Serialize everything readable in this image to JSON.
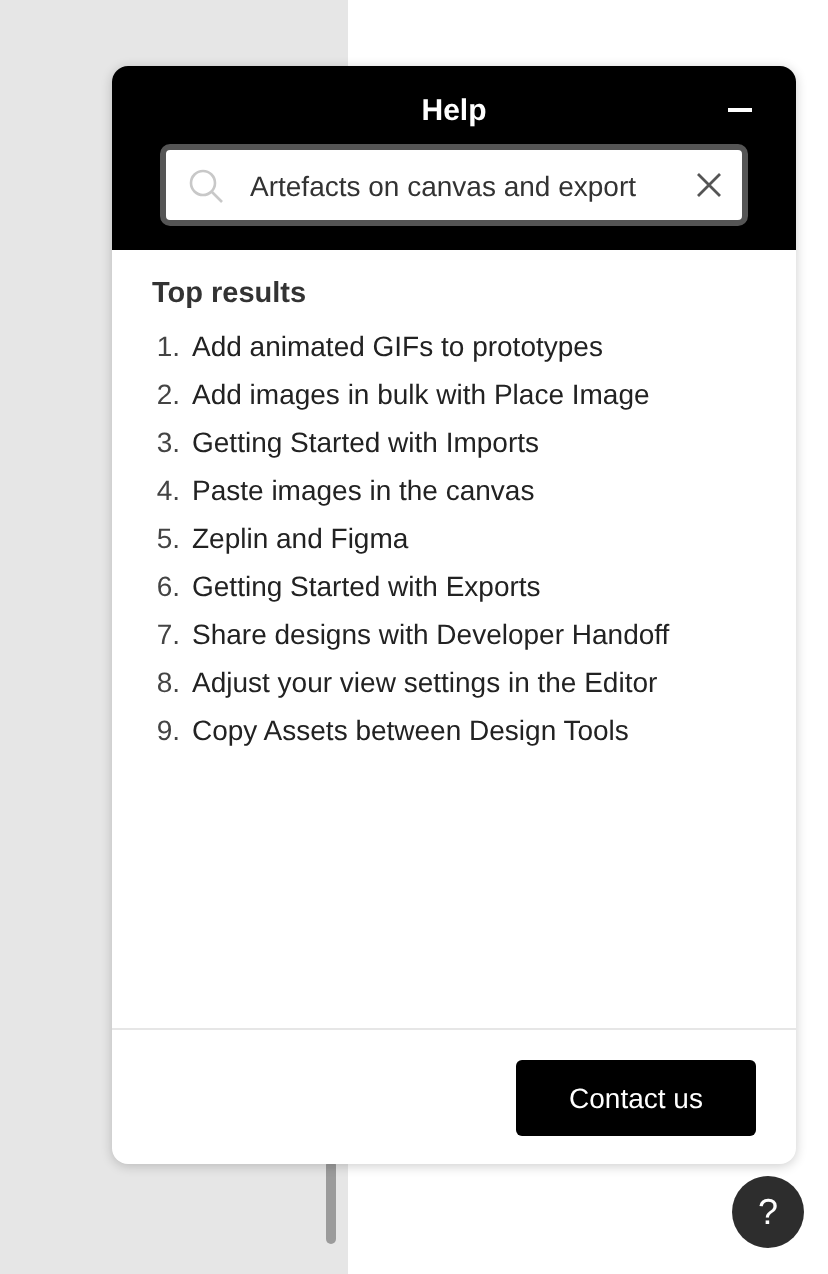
{
  "panel": {
    "title": "Help"
  },
  "search": {
    "value": "Artefacts on canvas and export"
  },
  "results": {
    "heading": "Top results",
    "items": [
      {
        "number": "1.",
        "title": "Add animated GIFs to prototypes"
      },
      {
        "number": "2.",
        "title": "Add images in bulk with Place Image"
      },
      {
        "number": "3.",
        "title": "Getting Started with Imports"
      },
      {
        "number": "4.",
        "title": "Paste images in the canvas"
      },
      {
        "number": "5.",
        "title": "Zeplin and Figma"
      },
      {
        "number": "6.",
        "title": "Getting Started with Exports"
      },
      {
        "number": "7.",
        "title": "Share designs with Developer Handoff"
      },
      {
        "number": "8.",
        "title": "Adjust your view settings in the Editor"
      },
      {
        "number": "9.",
        "title": "Copy Assets between Design Tools"
      }
    ]
  },
  "footer": {
    "button": "Contact us"
  },
  "help_button": "?"
}
